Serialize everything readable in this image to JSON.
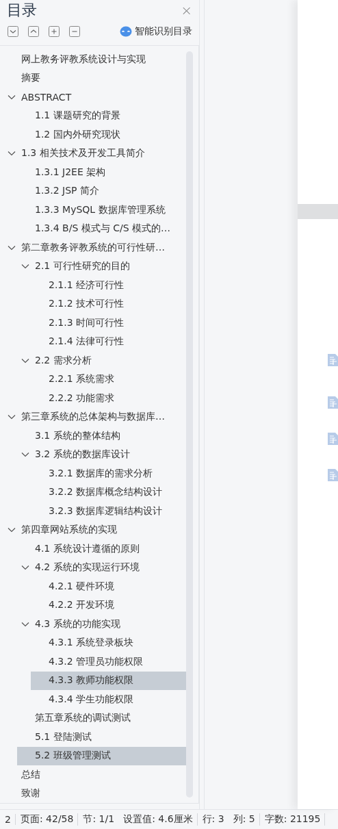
{
  "panel": {
    "title": "目录",
    "close": "×",
    "toolbar": [
      {
        "kind": "down"
      },
      {
        "kind": "up"
      },
      {
        "kind": "plus"
      },
      {
        "kind": "minus"
      }
    ],
    "smart_button": "智能识别目录"
  },
  "toc": [
    {
      "label": "网上教务评教系统设计与实现",
      "selected": false
    },
    {
      "label": "摘要",
      "selected": false
    },
    {
      "label": "ABSTRACT",
      "selected": false,
      "expanded": true,
      "children": [
        {
          "label": "1.1 课题研究的背景",
          "selected": false
        },
        {
          "label": "1.2 国内外研究现状",
          "selected": false
        }
      ]
    },
    {
      "label": "1.3 相关技术及开发工具简介",
      "selected": false,
      "expanded": true,
      "children": [
        {
          "label": "1.3.1 J2EE 架构",
          "selected": false
        },
        {
          "label": "1.3.2 JSP 简介",
          "selected": false
        },
        {
          "label": "1.3.3 MySQL 数据库管理系统",
          "selected": false
        },
        {
          "label": "1.3.4 B/S 模式与 C/S 模式的…",
          "selected": false
        }
      ]
    },
    {
      "label": "第二章教务评教系统的可行性研…",
      "selected": false,
      "expanded": true,
      "children": [
        {
          "label": "2.1  可行性研究的目的",
          "selected": false,
          "expanded": true,
          "children": [
            {
              "label": "2.1.1 经济可行性",
              "selected": false
            },
            {
              "label": "2.1.2 技术可行性",
              "selected": false
            },
            {
              "label": "2.1.3  时间可行性",
              "selected": false
            },
            {
              "label": "2.1.4 法律可行性",
              "selected": false
            }
          ]
        },
        {
          "label": "2.2 需求分析",
          "selected": false,
          "expanded": true,
          "children": [
            {
              "label": "2.2.1 系统需求",
              "selected": false
            },
            {
              "label": "2.2.2 功能需求",
              "selected": false
            }
          ]
        }
      ]
    },
    {
      "label": "第三章系统的总体架构与数据库…",
      "selected": false,
      "expanded": true,
      "children": [
        {
          "label": "3.1  系统的整体结构",
          "selected": false
        },
        {
          "label": "3.2  系统的数据库设计",
          "selected": false,
          "expanded": true,
          "children": [
            {
              "label": "3.2.1  数据库的需求分析",
              "selected": false
            },
            {
              "label": "3.2.2  数据库概念结构设计",
              "selected": false
            },
            {
              "label": "3.2.3 数据库逻辑结构设计",
              "selected": false
            }
          ]
        }
      ]
    },
    {
      "label": "第四章网站系统的实现",
      "selected": false,
      "expanded": true,
      "children": [
        {
          "label": "4.1  系统设计遵循的原则",
          "selected": false
        },
        {
          "label": "4.2  系统的实现运行环境",
          "selected": false,
          "expanded": true,
          "children": [
            {
              "label": "4.2.1 硬件环境",
              "selected": false
            },
            {
              "label": "4.2.2 开发环境",
              "selected": false
            }
          ]
        },
        {
          "label": "4.3  系统的功能实现",
          "selected": false,
          "expanded": true,
          "children": [
            {
              "label": "4.3.1  系统登录板块",
              "selected": false
            },
            {
              "label": "4.3.2 管理员功能权限",
              "selected": false
            },
            {
              "label": "4.3.3 教师功能权限",
              "selected": true
            },
            {
              "label": "4.3.4 学生功能权限",
              "selected": false
            }
          ]
        },
        {
          "label": "第五章系统的调试测试",
          "selected": false
        },
        {
          "label": "5.1 登陆测试",
          "selected": false
        },
        {
          "label": "5.2 班级管理测试",
          "selected": true
        }
      ]
    },
    {
      "label": "总结",
      "selected": false
    },
    {
      "label": "致谢",
      "selected": false
    }
  ],
  "status_bar": [
    {
      "text": "2",
      "divider": true
    },
    {
      "text": "页面: 42/58",
      "divider": true
    },
    {
      "text": "节: 1/1",
      "divider": false
    },
    {
      "text": "设置值: 4.6厘米",
      "divider": true
    },
    {
      "text": "行: 3",
      "divider": false
    },
    {
      "text": "列: 5",
      "divider": true
    },
    {
      "text": "字数: 21195",
      "divider": true
    }
  ]
}
